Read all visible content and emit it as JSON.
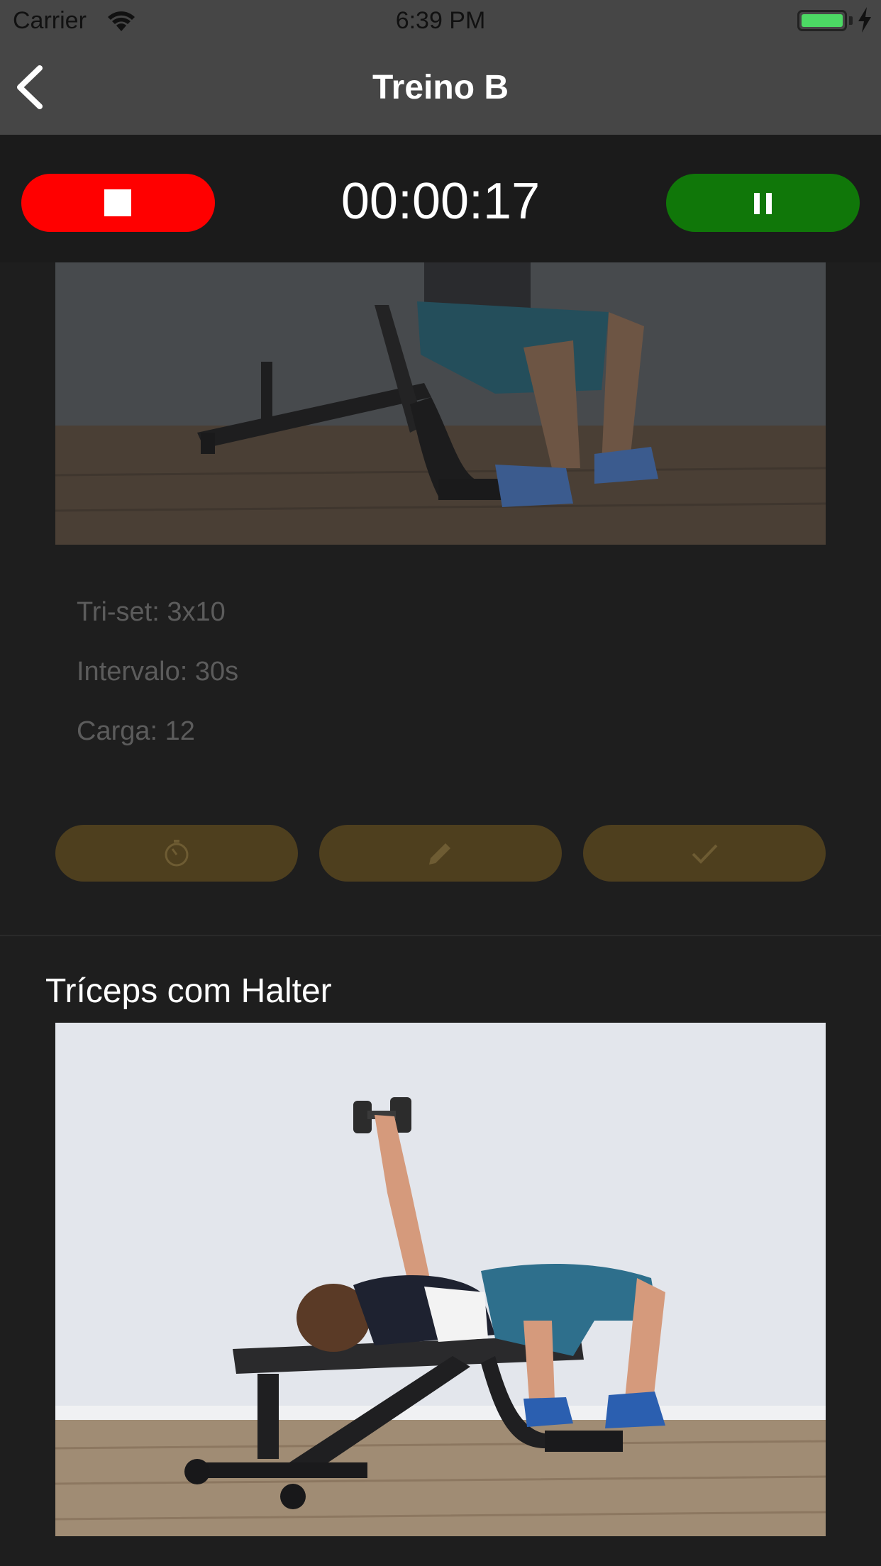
{
  "status_bar": {
    "carrier": "Carrier",
    "time": "6:39 PM"
  },
  "nav": {
    "title": "Treino B",
    "back_icon": "chevron-left-icon"
  },
  "timer": {
    "elapsed": "00:00:17",
    "stop_icon": "stop-icon",
    "pause_icon": "pause-icon",
    "colors": {
      "stop": "#ff0000",
      "pause": "#107709"
    }
  },
  "current_exercise": {
    "details": [
      "Tri-set: 3x10",
      "Intervalo: 30s",
      "Carga: 12"
    ],
    "actions": [
      {
        "icon": "timer-icon"
      },
      {
        "icon": "pencil-icon"
      },
      {
        "icon": "check-icon"
      }
    ],
    "action_color": "#4e3f1e"
  },
  "next_exercise": {
    "title": "Tríceps com Halter"
  }
}
